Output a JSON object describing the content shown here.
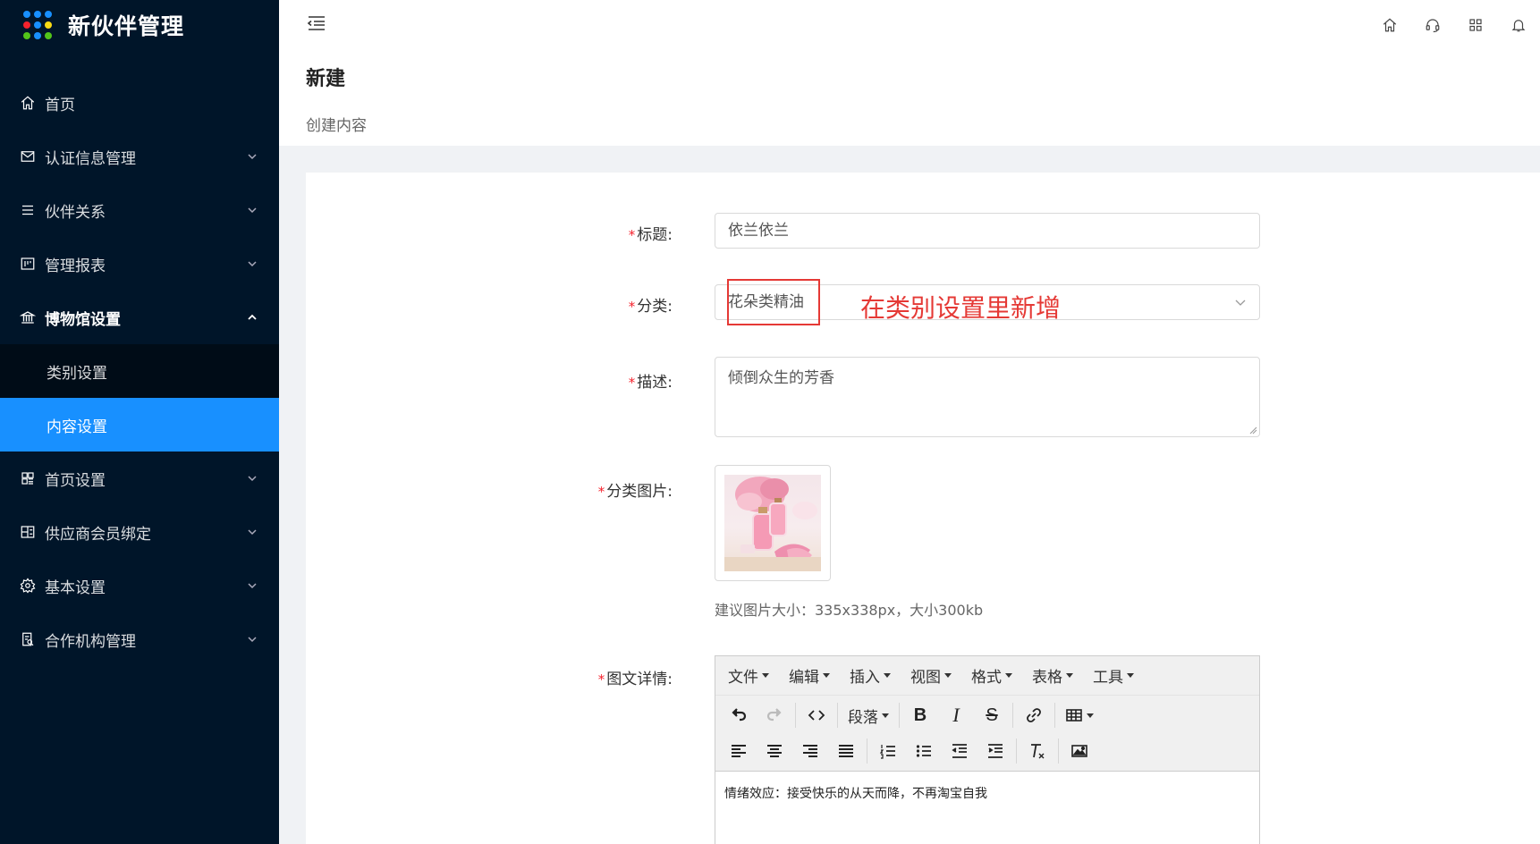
{
  "app": {
    "title": "新伙伴管理",
    "logo_dot_colors": [
      "#1890ff",
      "#1890ff",
      "#1890ff",
      "#f5222d",
      "#1890ff",
      "#fadb14",
      "#52c41a",
      "#1890ff",
      "#52c41a"
    ]
  },
  "sidebar": {
    "items": [
      {
        "label": "首页",
        "icon": "home-icon",
        "expandable": false
      },
      {
        "label": "认证信息管理",
        "icon": "mail-icon",
        "expandable": true
      },
      {
        "label": "伙伴关系",
        "icon": "list-icon",
        "expandable": true
      },
      {
        "label": "管理报表",
        "icon": "report-icon",
        "expandable": true
      },
      {
        "label": "博物馆设置",
        "icon": "bank-icon",
        "expandable": true,
        "open": true,
        "children": [
          {
            "label": "类别设置",
            "active": false
          },
          {
            "label": "内容设置",
            "active": true
          }
        ]
      },
      {
        "label": "首页设置",
        "icon": "layout-icon",
        "expandable": true
      },
      {
        "label": "供应商会员绑定",
        "icon": "block-icon",
        "expandable": true
      },
      {
        "label": "基本设置",
        "icon": "gear-icon",
        "expandable": true
      },
      {
        "label": "合作机构管理",
        "icon": "audit-icon",
        "expandable": true
      }
    ]
  },
  "header": {
    "icons": [
      "home-icon",
      "headset-icon",
      "apps-icon",
      "bell-icon"
    ]
  },
  "page": {
    "title": "新建",
    "subtitle": "创建内容"
  },
  "form": {
    "title_label": "标题:",
    "title_value": "依兰依兰",
    "category_label": "分类:",
    "category_value": "花朵类精油",
    "annotation": "在类别设置里新增",
    "desc_label": "描述:",
    "desc_value": "倾倒众生的芳香",
    "image_label": "分类图片:",
    "image_hint": "建议图片大小：335x338px，大小300kb",
    "detail_label": "图文详情:",
    "required_mark": "*"
  },
  "editor": {
    "menus": [
      "文件",
      "编辑",
      "插入",
      "视图",
      "格式",
      "表格",
      "工具"
    ],
    "paragraph_label": "段落",
    "content": "情绪效应：接受快乐的从天而降，不再淘宝自我"
  },
  "colors": {
    "sidebar_bg": "#001529",
    "active": "#1890ff",
    "annotation": "#e53935"
  }
}
